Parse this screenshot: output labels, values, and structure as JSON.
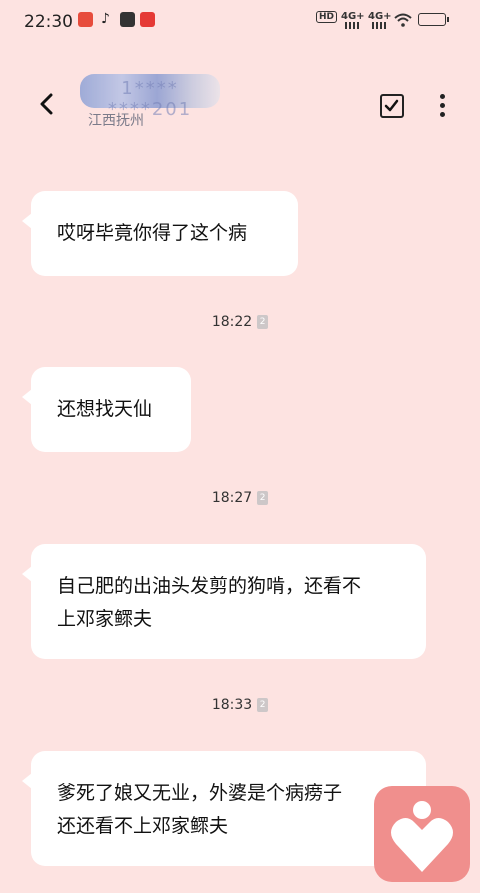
{
  "status_bar": {
    "time": "22:30",
    "network_1": "4G+",
    "network_2": "4G+",
    "hd_label": "HD",
    "colors": {
      "app1": "#e74c3c",
      "app3": "#333333",
      "app4": "#e53935"
    }
  },
  "header": {
    "contact_name_partial": "1**** ****201",
    "location": "江西抚州",
    "back_icon": "chevron-left-icon",
    "select_icon": "checkbox-icon",
    "menu_icon": "more-vertical-icon"
  },
  "messages": [
    {
      "text_lines": [
        "哎呀毕竟你得了这个病"
      ]
    },
    {
      "timestamp": "18:22",
      "sim": "2",
      "text_lines": [
        "还想找天仙"
      ]
    },
    {
      "timestamp": "18:27",
      "sim": "2",
      "text_lines": [
        "自己肥的出油头发剪的狗啃，还看不",
        "上邓家鳏夫"
      ]
    },
    {
      "timestamp": "18:33",
      "sim": "2",
      "text_lines": [
        "爹死了娘又无业，外婆是个病痨子",
        "还还看不上邓家鳏夫"
      ]
    }
  ],
  "floating_app": {
    "icon": "heart-person-icon",
    "color": "#f08f8d"
  }
}
